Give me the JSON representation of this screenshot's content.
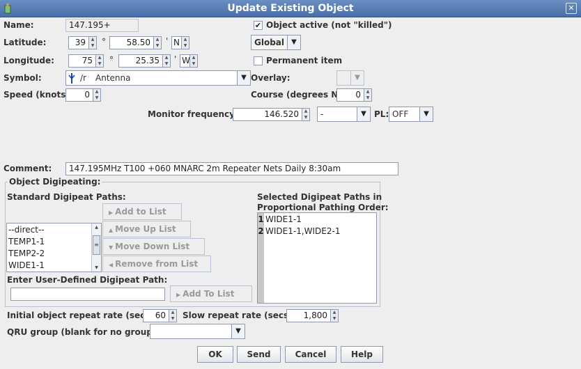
{
  "window": {
    "title": "Update Existing Object",
    "close_icon": "close-icon"
  },
  "name": {
    "label": "Name:",
    "value": "147.195+"
  },
  "object_active": {
    "label": "Object active (not \"killed\")",
    "checked": true
  },
  "latitude": {
    "label": "Latitude:",
    "degrees": "39",
    "deg_symbol": "°",
    "minutes": "58.50",
    "min_symbol": "'",
    "hemisphere": "N"
  },
  "longitude": {
    "label": "Longitude:",
    "degrees": "75",
    "deg_symbol": "°",
    "minutes": "25.35",
    "min_symbol": "'",
    "hemisphere": "W"
  },
  "scope": {
    "selected": "Global"
  },
  "permanent": {
    "label": "Permanent item",
    "checked": false
  },
  "symbol": {
    "label": "Symbol:",
    "code": "/r",
    "name": "Antenna"
  },
  "overlay": {
    "label": "Overlay:",
    "value": ""
  },
  "speed": {
    "label": "Speed (knots):",
    "value": "0"
  },
  "course": {
    "label": "Course (degrees N):",
    "value": "0"
  },
  "monitor": {
    "label": "Monitor frequency:",
    "value": "146.520",
    "offset": "-",
    "pl_label": "PL:",
    "pl_value": "OFF"
  },
  "comment": {
    "label": "Comment:",
    "value": "147.195MHz T100 +060 MNARC 2m Repeater Nets Daily 8:30am"
  },
  "digipeat": {
    "group_title": "Object Digipeating:",
    "standard_label": "Standard Digipeat Paths:",
    "standard_paths": [
      "--direct--",
      "TEMP1-1",
      "TEMP2-2",
      "WIDE1-1"
    ],
    "selected_label_1": "Selected Digipeat Paths in",
    "selected_label_2": "Proportional Pathing Order:",
    "selected_paths": [
      {
        "n": "1",
        "path": "WIDE1-1"
      },
      {
        "n": "2",
        "path": "WIDE1-1,WIDE2-1"
      }
    ],
    "add_to_list": "Add to List",
    "move_up": "Move Up List",
    "move_down": "Move Down List",
    "remove": "Remove from List",
    "user_defined_label": "Enter User-Defined Digipeat Path:",
    "user_defined_value": "",
    "add_to_list_2": "Add To List"
  },
  "repeat": {
    "initial_label": "Initial object repeat rate (secs):",
    "initial_value": "60",
    "slow_label": "Slow repeat rate (secs):",
    "slow_value": "1,800"
  },
  "qru": {
    "label": "QRU group (blank for no group):",
    "value": ""
  },
  "buttons": {
    "ok": "OK",
    "send": "Send",
    "cancel": "Cancel",
    "help": "Help"
  },
  "colors": {
    "titlebar": "#4a6ea8",
    "background": "#eeeeee",
    "border": "#8e9aab"
  }
}
